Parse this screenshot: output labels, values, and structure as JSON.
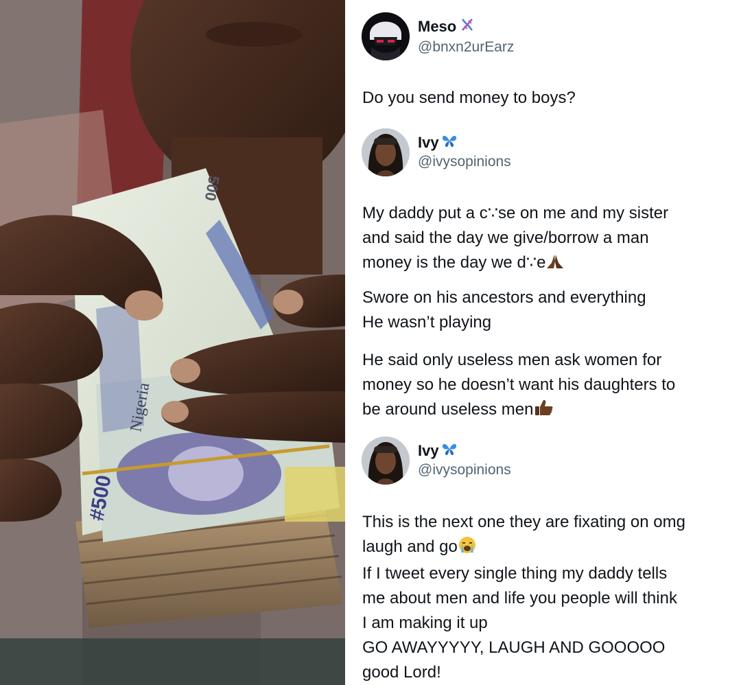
{
  "left_photo": {
    "banknote_text": [
      "#500",
      "500",
      "Nigeria"
    ]
  },
  "tweets": [
    {
      "display_name": "Meso",
      "name_badge_icon": "dna-icon",
      "handle": "@bnxn2urEarz",
      "paragraphs": [
        [
          "Do you send money to boys?"
        ]
      ]
    },
    {
      "display_name": "Ivy",
      "name_badge_icon": "butterfly-icon",
      "handle": "@ivysopinions",
      "paragraphs": [
        [
          "My daddy put a c∵se on me and my sister",
          "and said the day we give/borrow a man",
          "money is the day we d∵e"
        ],
        [
          "Swore on his ancestors and everything",
          "He wasn’t playing"
        ],
        [
          "He said only useless men ask women for",
          "money so he doesn’t want his daughters to",
          "be around useless men"
        ]
      ],
      "emojis": [
        "folded-hands-emoji",
        "thumbs-up-emoji"
      ]
    },
    {
      "display_name": "Ivy",
      "name_badge_icon": "butterfly-icon",
      "handle": "@ivysopinions",
      "paragraphs": [
        [
          "This is the next one they are fixating on omg",
          "laugh and go",
          "If I tweet every single thing my daddy tells",
          "me about men and life you people will think",
          "I am making it up",
          "GO AWAYYYYY, LAUGH AND GOOOOO",
          "good Lord!"
        ]
      ],
      "emojis": [
        "loudly-crying-emoji"
      ]
    }
  ]
}
